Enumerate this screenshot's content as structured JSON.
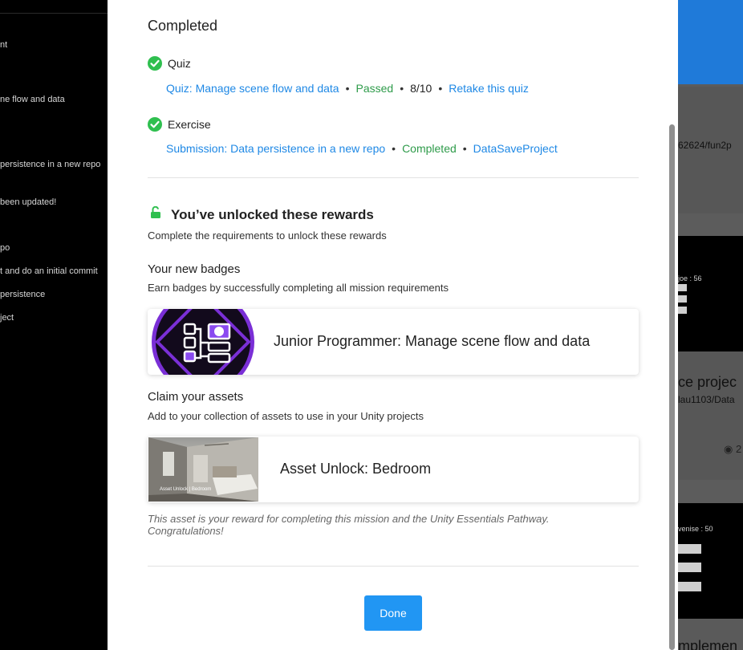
{
  "sidebar": {
    "items": [
      "nt",
      "ne flow and data",
      "persistence in a new repo",
      "been updated!",
      "po",
      "t and do an initial commit",
      "persistence",
      "ject"
    ]
  },
  "background_right": {
    "path_snippet_1": "62624/fun2p",
    "label_1": "joe : 56",
    "project_title": "ce projec",
    "path_snippet_2": "lau1103/Data",
    "views_digit": "2",
    "label_2": "venise : 50",
    "bottom_title": "mplemen"
  },
  "completed": {
    "title": "Completed",
    "quiz": {
      "label": "Quiz",
      "link": "Quiz: Manage scene flow and data",
      "status": "Passed",
      "score": "8/10",
      "retake": "Retake this quiz"
    },
    "exercise": {
      "label": "Exercise",
      "link": "Submission: Data persistence in a new repo",
      "status": "Completed",
      "project": "DataSaveProject"
    }
  },
  "rewards": {
    "title": "You’ve unlocked these rewards",
    "subtitle": "Complete the requirements to unlock these rewards",
    "badges_heading": "Your new badges",
    "badges_sub": "Earn badges by successfully completing all mission requirements",
    "badge_name": "Junior Programmer: Manage scene flow and data",
    "assets_heading": "Claim your assets",
    "assets_sub": "Add to your collection of assets to use in your Unity projects",
    "asset_name": "Asset Unlock: Bedroom",
    "asset_caption": "Asset Unlock | Bedroom",
    "note": "This asset is your reward for completing this mission and the Unity Essentials Pathway. Congratulations!"
  },
  "actions": {
    "done_label": "Done"
  },
  "colors": {
    "link": "#1e88e5",
    "success": "#2e9b4a",
    "check": "#2fbf4f",
    "primary_button": "#2196f3",
    "badge_purple": "#7a2fd6"
  },
  "icons": [
    "check-circle-icon",
    "unlock-icon"
  ]
}
